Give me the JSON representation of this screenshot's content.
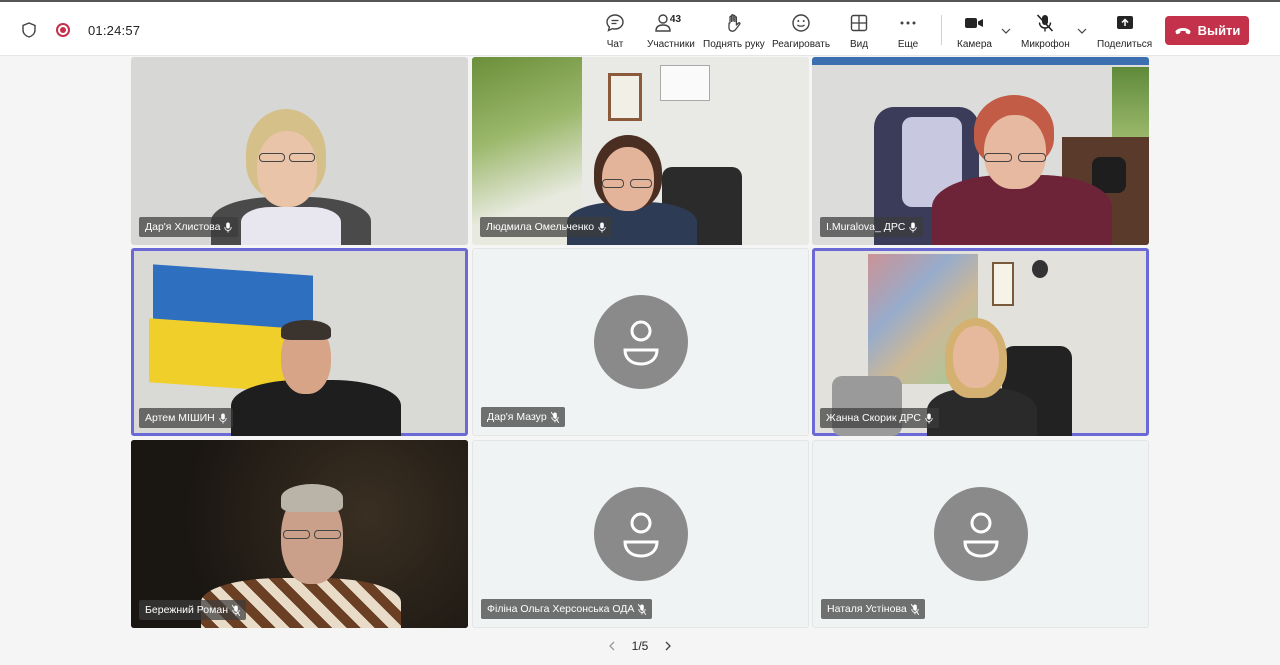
{
  "meeting": {
    "timer": "01:24:57",
    "participants_count": "43"
  },
  "toolbar": {
    "chat": "Чат",
    "participants": "Участники",
    "raise_hand": "Поднять руку",
    "react": "Реагировать",
    "view": "Вид",
    "more": "Еще",
    "camera": "Камера",
    "mic": "Микрофон",
    "share": "Поделиться",
    "leave": "Выйти"
  },
  "tiles": [
    {
      "name": "Дар'я Хлистова"
    },
    {
      "name": "Людмила Омельченко"
    },
    {
      "name": "I.Muralova_ ДРС"
    },
    {
      "name": "Артем МІШИН"
    },
    {
      "name": "Дар'я Мазур"
    },
    {
      "name": "Жанна Скорик ДРС"
    },
    {
      "name": "Бережний Роман"
    },
    {
      "name": "Філіна Ольга Херсонська ОДА"
    },
    {
      "name": "Наталя Устінова"
    }
  ],
  "pager": {
    "label": "1/5"
  },
  "colors": {
    "leave": "#c4314b",
    "active_speaker": "#6b69d6",
    "recording": "#c4314b"
  }
}
